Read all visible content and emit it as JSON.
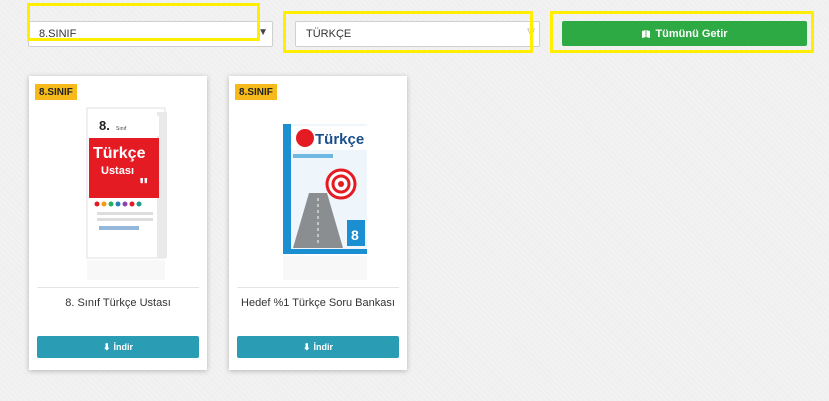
{
  "filters": {
    "class_select": {
      "value": "8.SINIF"
    },
    "subject_select": {
      "value": "TÜRKÇE"
    },
    "fetch_all_label": "Tümünü Getir"
  },
  "products": [
    {
      "badge": "8.SINIF",
      "title": "8. Sınıf Türkçe Ustası",
      "download_label": "İndir",
      "cover": {
        "grade": "8.",
        "grade_word": "Sınıf",
        "title": "Türkçe",
        "subtitle": "Ustası"
      }
    },
    {
      "badge": "8.SINIF",
      "title": "Hedef %1 Türkçe Soru Bankası",
      "download_label": "İndir",
      "cover": {
        "title": "Türkçe",
        "grade": "8"
      }
    }
  ],
  "colors": {
    "highlight": "#ffee00",
    "green_button": "#2eaa44",
    "download_button": "#2a9cb4",
    "badge": "#f6bb1a"
  },
  "icons": {
    "fetch_all": "book-icon",
    "download": "download-icon",
    "dropdown": "caret-down-icon"
  }
}
